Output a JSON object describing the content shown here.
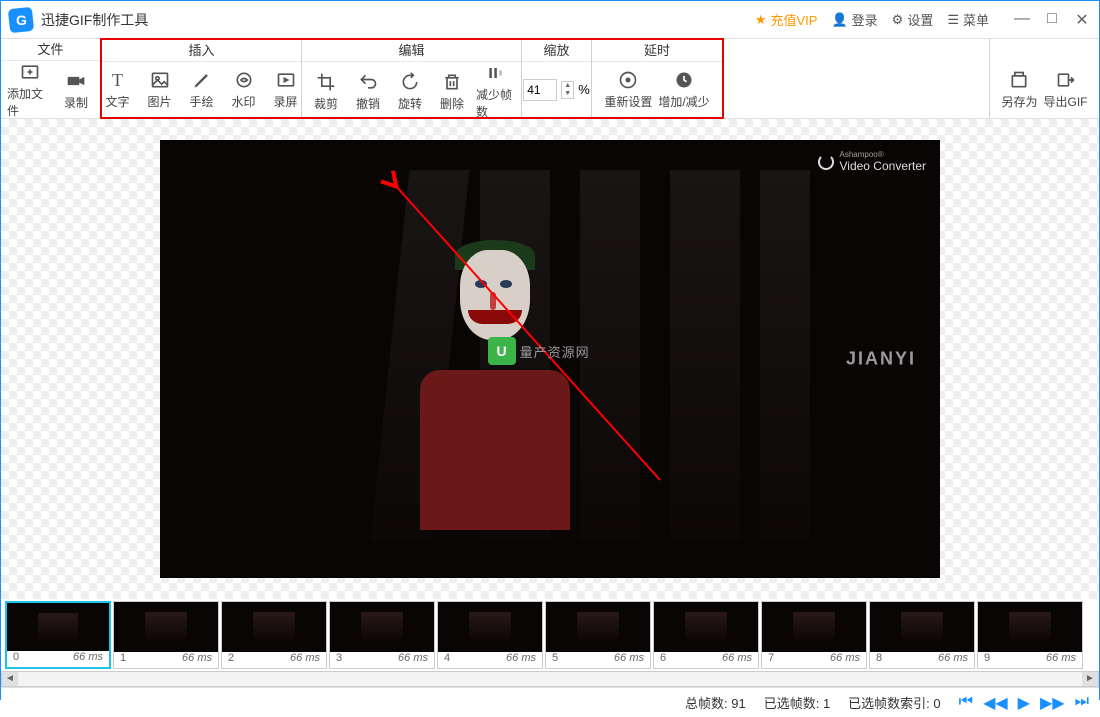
{
  "titlebar": {
    "app_title": "迅捷GIF制作工具",
    "vip": "充值VIP",
    "login": "登录",
    "settings": "设置",
    "menu": "菜单"
  },
  "toolbar": {
    "groups": {
      "file": {
        "header": "文件",
        "add_file": "添加文件",
        "record": "录制"
      },
      "insert": {
        "header": "插入",
        "text": "文字",
        "image": "图片",
        "draw": "手绘",
        "watermark": "水印",
        "screen": "录屏"
      },
      "edit": {
        "header": "编辑",
        "crop": "裁剪",
        "undo": "撤销",
        "rotate": "旋转",
        "delete": "删除",
        "reduce_frames": "减少帧数"
      },
      "zoom": {
        "header": "缩放",
        "value": "41",
        "unit": "%"
      },
      "delay": {
        "header": "延时",
        "reset": "重新设置",
        "incdec": "增加/减少"
      },
      "export": {
        "save_as": "另存为",
        "export_gif": "导出GIF"
      }
    }
  },
  "preview": {
    "watermark_vc": "Video Converter",
    "watermark_vc_brand": "Ashampoo®",
    "jianyi": "JIANYI",
    "center_text": "量产资源网",
    "center_logo": "U"
  },
  "frames": [
    {
      "idx": "0",
      "ms": "66 ms"
    },
    {
      "idx": "1",
      "ms": "66 ms"
    },
    {
      "idx": "2",
      "ms": "66 ms"
    },
    {
      "idx": "3",
      "ms": "66 ms"
    },
    {
      "idx": "4",
      "ms": "66 ms"
    },
    {
      "idx": "5",
      "ms": "66 ms"
    },
    {
      "idx": "6",
      "ms": "66 ms"
    },
    {
      "idx": "7",
      "ms": "66 ms"
    },
    {
      "idx": "8",
      "ms": "66 ms"
    },
    {
      "idx": "9",
      "ms": "66 ms"
    }
  ],
  "status": {
    "total_frames_label": "总帧数:",
    "total_frames": "91",
    "selected_frames_label": "已选帧数:",
    "selected_frames": "1",
    "selected_index_label": "已选帧数索引:",
    "selected_index": "0"
  }
}
